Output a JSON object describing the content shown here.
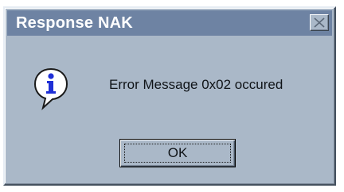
{
  "window": {
    "title": "Response NAK",
    "close_icon": "close-icon"
  },
  "dialog": {
    "icon": "info-icon",
    "message": "Error Message 0x02 occured"
  },
  "buttons": {
    "ok_label": "OK"
  },
  "colors": {
    "titlebar": "#6e83a3",
    "body": "#aab8c8",
    "icon_blue": "#1f2fd6"
  }
}
